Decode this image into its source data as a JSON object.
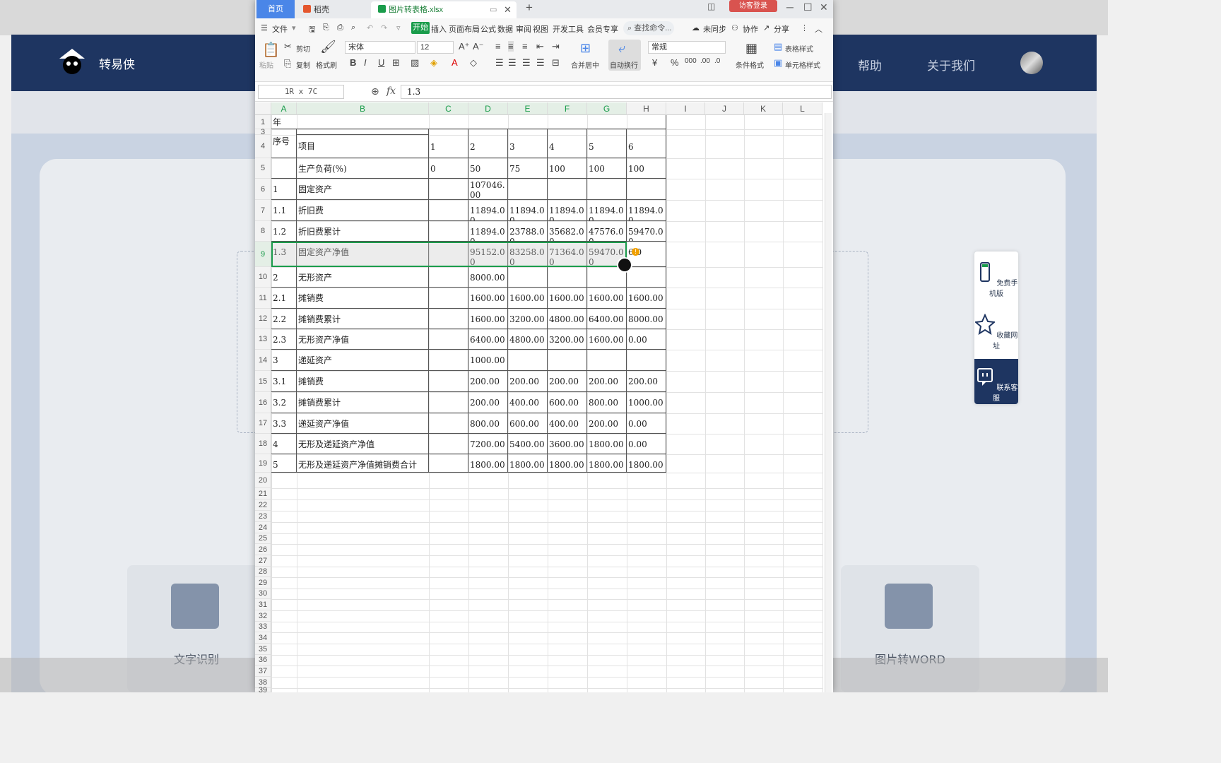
{
  "website": {
    "brand": "转易侠",
    "nav": [
      "帮助",
      "关于我们"
    ],
    "features": [
      "文字识别",
      "图片转WORD"
    ],
    "float": [
      "免费手机版",
      "收藏网址",
      "联系客服"
    ]
  },
  "app": {
    "tabs": {
      "home": "首页",
      "daoke": "稻壳",
      "file": "图片转表格.xlsx"
    },
    "guest_login": "访客登录",
    "menu": {
      "file": "文件",
      "start": "开始",
      "items": [
        "插入",
        "页面布局",
        "公式",
        "数据",
        "审阅",
        "视图",
        "开发工具",
        "会员专享"
      ],
      "search": "查找命令...",
      "right": [
        "未同步",
        "协作",
        "分享"
      ]
    },
    "ribbon": {
      "paste": "粘贴",
      "cut": "剪切",
      "copy": "复制",
      "format_painter": "格式刷",
      "font": "宋体",
      "size": "12",
      "merge": "合并居中",
      "wrap": "自动换行",
      "number_format": "常规",
      "cond_format": "条件格式",
      "table_style": "表格样式",
      "cell_style": "单元格样式"
    },
    "namebox": "1R x 7C",
    "formula": "1.3"
  },
  "sheet": {
    "columns": [
      "A",
      "B",
      "C",
      "D",
      "E",
      "F",
      "G",
      "H",
      "I",
      "J",
      "K",
      "L"
    ],
    "row_numbers": [
      "1",
      "3",
      "4",
      "5",
      "6",
      "7",
      "8",
      "9",
      "10",
      "11",
      "12",
      "13",
      "14",
      "15",
      "16",
      "17",
      "18",
      "19",
      "20",
      "21",
      "22",
      "23",
      "24",
      "25",
      "26",
      "27",
      "28",
      "29",
      "30",
      "31",
      "32",
      "33",
      "34",
      "35",
      "36",
      "37",
      "38",
      "39"
    ],
    "title": "年",
    "seq_header": "序号",
    "item_header": "项目",
    "years": [
      "1",
      "2",
      "3",
      "4",
      "5",
      "6"
    ],
    "rows": [
      {
        "seq": "",
        "item": "生产负荷(%)",
        "vals": [
          "0",
          "50",
          "75",
          "100",
          "100",
          "100"
        ]
      },
      {
        "seq": "1",
        "item": "固定资产",
        "vals": [
          "",
          "107046.00",
          "",
          "",
          "",
          ""
        ]
      },
      {
        "seq": "1.1",
        "item": "折旧费",
        "vals": [
          "",
          "11894.00",
          "11894.00",
          "11894.00",
          "11894.00",
          "11894.00"
        ]
      },
      {
        "seq": "1.2",
        "item": "折旧费累计",
        "vals": [
          "",
          "11894.00",
          "23788.00",
          "35682.00",
          "47576.00",
          "59470.00"
        ]
      },
      {
        "seq": "1.3",
        "item": "固定资产净值",
        "vals": [
          "",
          "95152.00",
          "83258.00",
          "71364.00",
          "59470.00",
          "6.0"
        ]
      },
      {
        "seq": "2",
        "item": "无形资产",
        "vals": [
          "",
          "8000.00",
          "",
          "",
          "",
          ""
        ]
      },
      {
        "seq": "2.1",
        "item": "摊销费",
        "vals": [
          "",
          "1600.00",
          "1600.00",
          "1600.00",
          "1600.00",
          "1600.00"
        ]
      },
      {
        "seq": "2.2",
        "item": "摊销费累计",
        "vals": [
          "",
          "1600.00",
          "3200.00",
          "4800.00",
          "6400.00",
          "8000.00"
        ]
      },
      {
        "seq": "2.3",
        "item": "无形资产净值",
        "vals": [
          "",
          "6400.00",
          "4800.00",
          "3200.00",
          "1600.00",
          "0.00"
        ]
      },
      {
        "seq": "3",
        "item": "递延资产",
        "vals": [
          "",
          "1000.00",
          "",
          "",
          "",
          ""
        ]
      },
      {
        "seq": "3.1",
        "item": "摊销费",
        "vals": [
          "",
          "200.00",
          "200.00",
          "200.00",
          "200.00",
          "200.00"
        ]
      },
      {
        "seq": "3.2",
        "item": "摊销费累计",
        "vals": [
          "",
          "200.00",
          "400.00",
          "600.00",
          "800.00",
          "1000.00"
        ]
      },
      {
        "seq": "3.3",
        "item": "递延资产净值",
        "vals": [
          "",
          "800.00",
          "600.00",
          "400.00",
          "200.00",
          "0.00"
        ]
      },
      {
        "seq": "4",
        "item": "无形及递延资产净值",
        "vals": [
          "",
          "7200.00",
          "5400.00",
          "3600.00",
          "1800.00",
          "0.00"
        ]
      },
      {
        "seq": "5",
        "item": "无形及递延资产净值摊销费合计",
        "vals": [
          "",
          "1800.00",
          "1800.00",
          "1800.00",
          "1800.00",
          "1800.00"
        ]
      }
    ]
  },
  "colors": {
    "nav": "#1e3561",
    "accent": "#1a9c4b",
    "home_tab": "#4a86e8",
    "guest": "#d9534f"
  }
}
